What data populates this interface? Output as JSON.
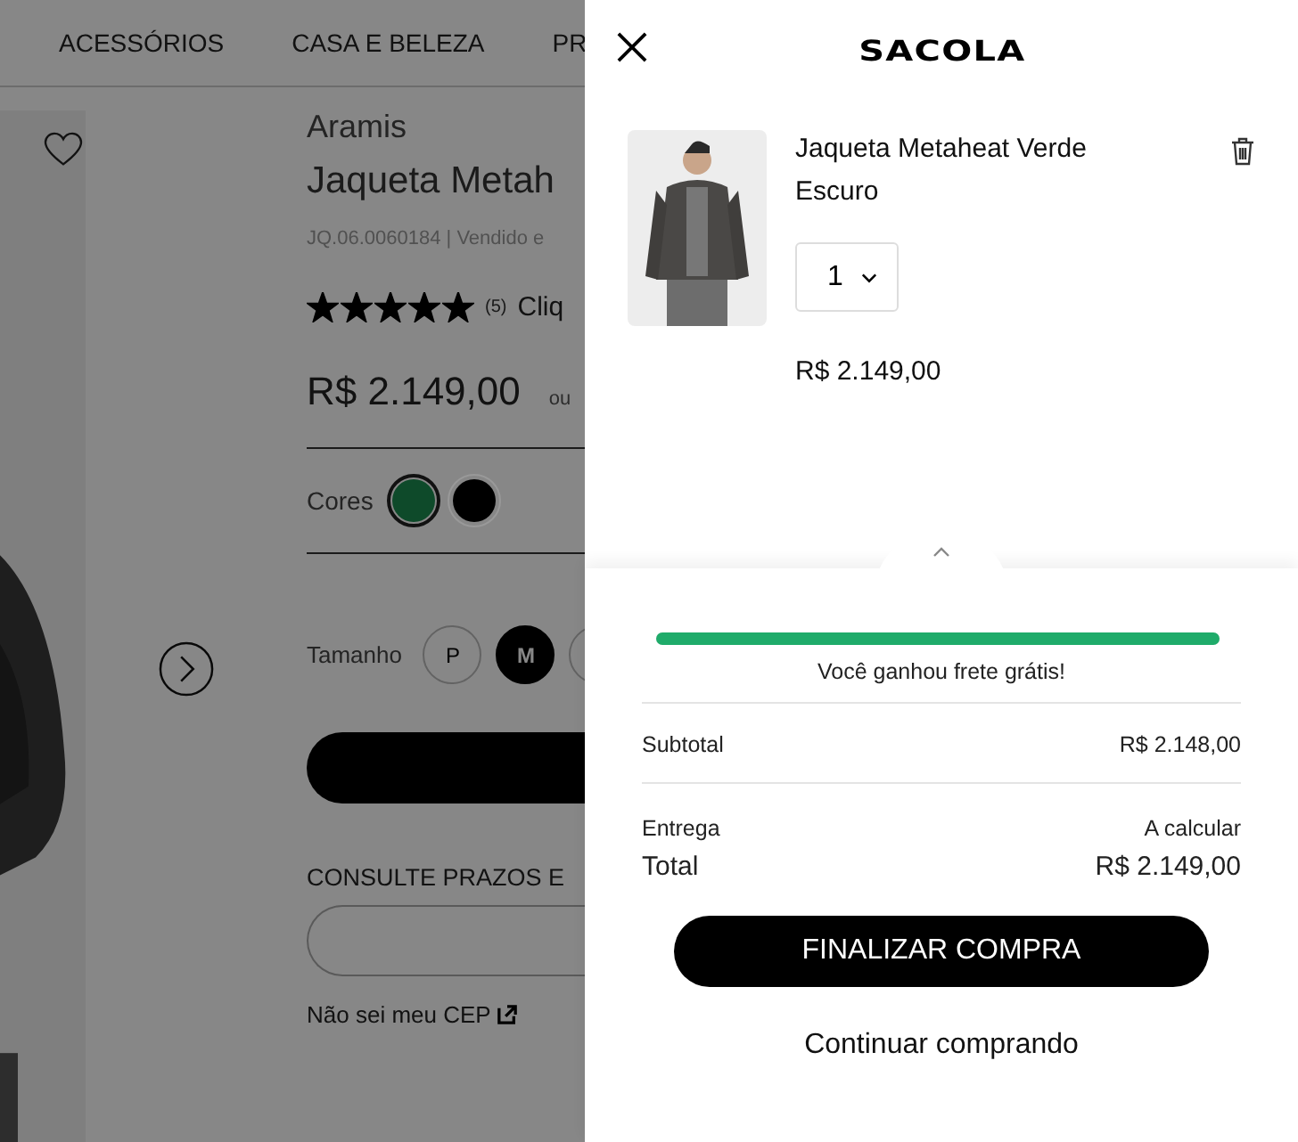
{
  "nav": {
    "items": [
      "ACESSÓRIOS",
      "CASA E BELEZA",
      "PR"
    ]
  },
  "product": {
    "brand": "Aramis",
    "title": "Jaqueta Metah",
    "code_line": "JQ.06.0060184  |  Vendido e",
    "stars": 5,
    "review_count": "(5)",
    "reviews_link": "Cliq",
    "price": "R$ 2.149,00",
    "installments": "ou",
    "colors_label": "Cores",
    "colors": [
      {
        "color": "#0e4a2a",
        "selected": true
      },
      {
        "color": "#000000",
        "selected": false
      }
    ],
    "size_label": "Tamanho",
    "sizes": [
      {
        "label": "P",
        "selected": false
      },
      {
        "label": "M",
        "selected": true
      },
      {
        "selected": false
      }
    ],
    "shipping_heading": "CONSULTE PRAZOS E",
    "cep_link": "Não sei meu CEP"
  },
  "cart": {
    "title": "SACOLA",
    "items": [
      {
        "name": "Jaqueta Metaheat Verde Escuro",
        "quantity": "1",
        "price": "R$ 2.149,00"
      }
    ],
    "free_shipping": {
      "level": 1,
      "message": "Você ganhou frete grátis!"
    },
    "summary": [
      {
        "label": "Subtotal",
        "value": "R$ 2.148,00",
        "kind": "line"
      },
      {
        "label": "Entrega",
        "value": "A calcular",
        "kind": "plain"
      },
      {
        "label": "Total",
        "value": "R$ 2.149,00",
        "kind": "total"
      }
    ],
    "checkout_button": "FINALIZAR COMPRA",
    "continue_link": "Continuar comprando"
  }
}
